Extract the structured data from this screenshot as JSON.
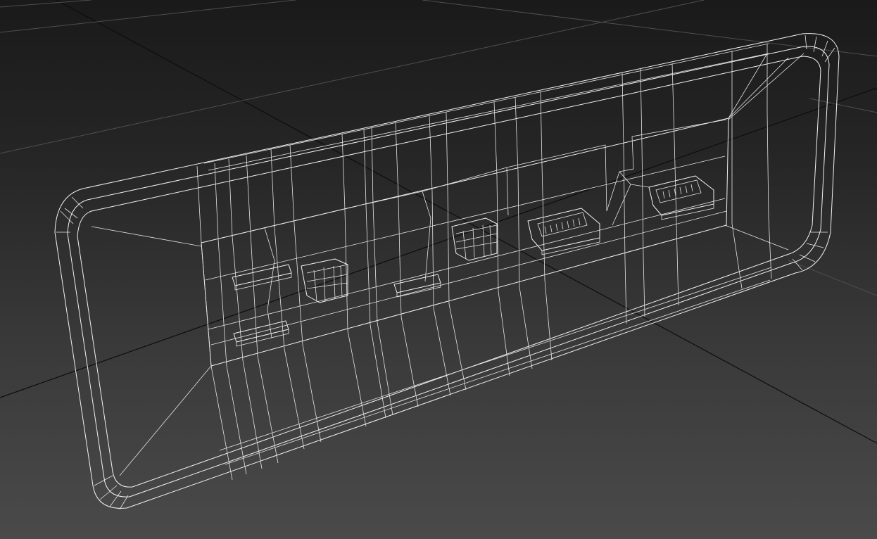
{
  "viewport": {
    "background_top": "#1a1a1a",
    "background_bottom": "#4a4a4a",
    "wire_color": "#f2f2f2",
    "grid_major_color": "#0d0d0d",
    "grid_minor_color": "#4e4e4e",
    "shading_mode": "wireframe",
    "object": "rounded-panel-with-ports"
  }
}
